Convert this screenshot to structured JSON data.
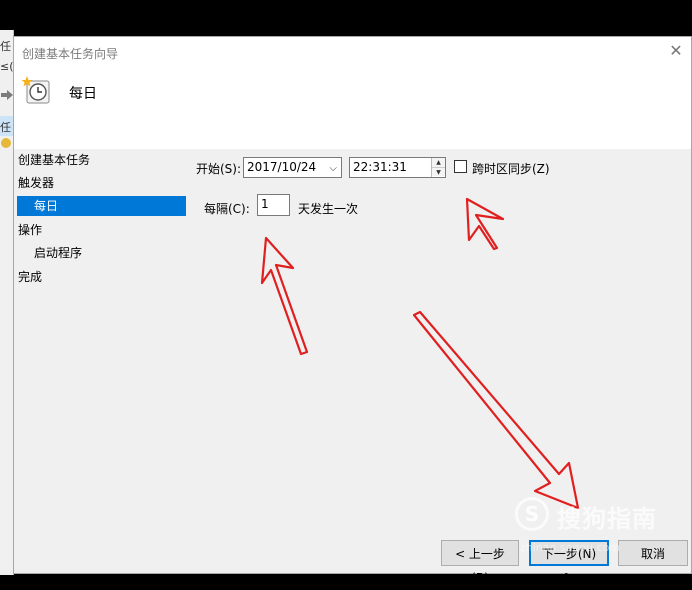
{
  "background_app": {
    "fragments": [
      "任",
      "≤(F",
      "任"
    ]
  },
  "window": {
    "title": "创建基本任务向导",
    "close_glyph": "✕"
  },
  "header": {
    "title": "每日"
  },
  "nav": {
    "items": [
      {
        "label": "创建基本任务"
      },
      {
        "label": "触发器"
      },
      {
        "label": "每日"
      },
      {
        "label": "操作"
      },
      {
        "label": "启动程序"
      },
      {
        "label": "完成"
      }
    ]
  },
  "form": {
    "start_label": "开始(S):",
    "start_date": "2017/10/24",
    "start_time": "22:31:31",
    "sync_tz_label": "跨时区同步(Z)",
    "sync_tz_checked": false,
    "recur_label": "每隔(C):",
    "recur_value": "1",
    "recur_suffix": "天发生一次"
  },
  "buttons": {
    "back": "< 上一步(B)",
    "next": "下一步(N) >",
    "cancel": "取消"
  },
  "watermark": {
    "logo_letter": "S",
    "text": "搜狗指南",
    "sub": "zhinan.sogou.com"
  },
  "colors": {
    "selection": "#0078d7",
    "annotation_arrow": "#e02020"
  },
  "icons": {
    "header": "scheduled-task-clock-icon",
    "date_dropdown": "chevron-down-icon",
    "time_spin": "spin-updown-icon"
  }
}
